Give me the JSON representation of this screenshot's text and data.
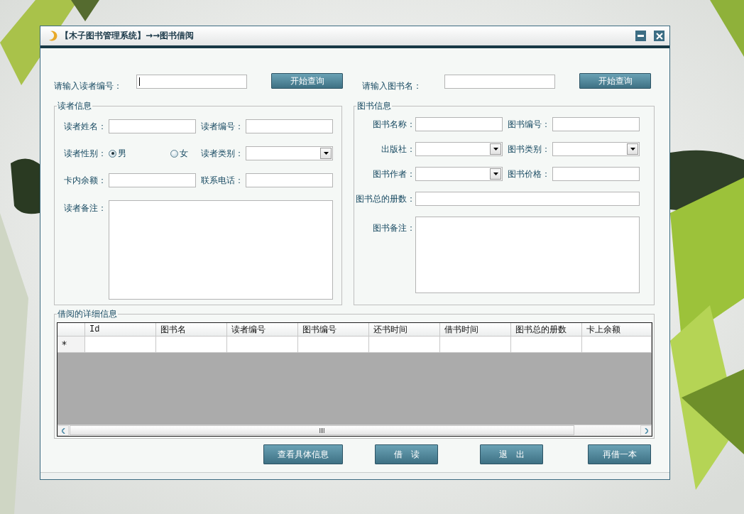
{
  "window": {
    "title": "【木子图书管理系统】→→图书借阅"
  },
  "reader_search": {
    "label": "请输入读者编号：",
    "focused": true,
    "button": "开始查询"
  },
  "book_search": {
    "label": "请输入图书名：",
    "focused": false,
    "button": "开始查询"
  },
  "reader_info": {
    "legend": "读者信息",
    "rows": [
      [
        {
          "label": "读者姓名：",
          "kind": "text"
        },
        {
          "label": "读者编号：",
          "kind": "text"
        }
      ],
      [
        {
          "label": "读者性别：",
          "kind": "radio",
          "options": [
            {
              "label": "男",
              "selected": true
            },
            {
              "label": "女",
              "selected": false
            }
          ]
        },
        {
          "label": "读者类别：",
          "kind": "select"
        }
      ],
      [
        {
          "label": "卡内余额：",
          "kind": "text"
        },
        {
          "label": "联系电话：",
          "kind": "text"
        }
      ],
      [
        {
          "label": "读者备注：",
          "kind": "textarea"
        }
      ]
    ]
  },
  "book_info": {
    "legend": "图书信息",
    "rows": [
      [
        {
          "label": "图书名称：",
          "kind": "text"
        },
        {
          "label": "图书编号：",
          "kind": "text"
        }
      ],
      [
        {
          "label": "出版社：",
          "kind": "select"
        },
        {
          "label": "图书类别：",
          "kind": "select"
        }
      ],
      [
        {
          "label": "图书作者：",
          "kind": "select"
        },
        {
          "label": "图书价格：",
          "kind": "text"
        }
      ],
      [
        {
          "label": "图书总的册数：",
          "kind": "wide"
        }
      ],
      [
        {
          "label": "图书备注：",
          "kind": "textarea"
        }
      ]
    ]
  },
  "borrow_details": {
    "legend": "借阅的详细信息",
    "columns": [
      "Id",
      "图书名",
      "读者编号",
      "图书编号",
      "还书时间",
      "借书时间",
      "图书总的册数",
      "卡上余额"
    ],
    "new_row_marker": "*"
  },
  "buttons": [
    "查看具体信息",
    "借　读",
    "退　出",
    "再借一本"
  ]
}
